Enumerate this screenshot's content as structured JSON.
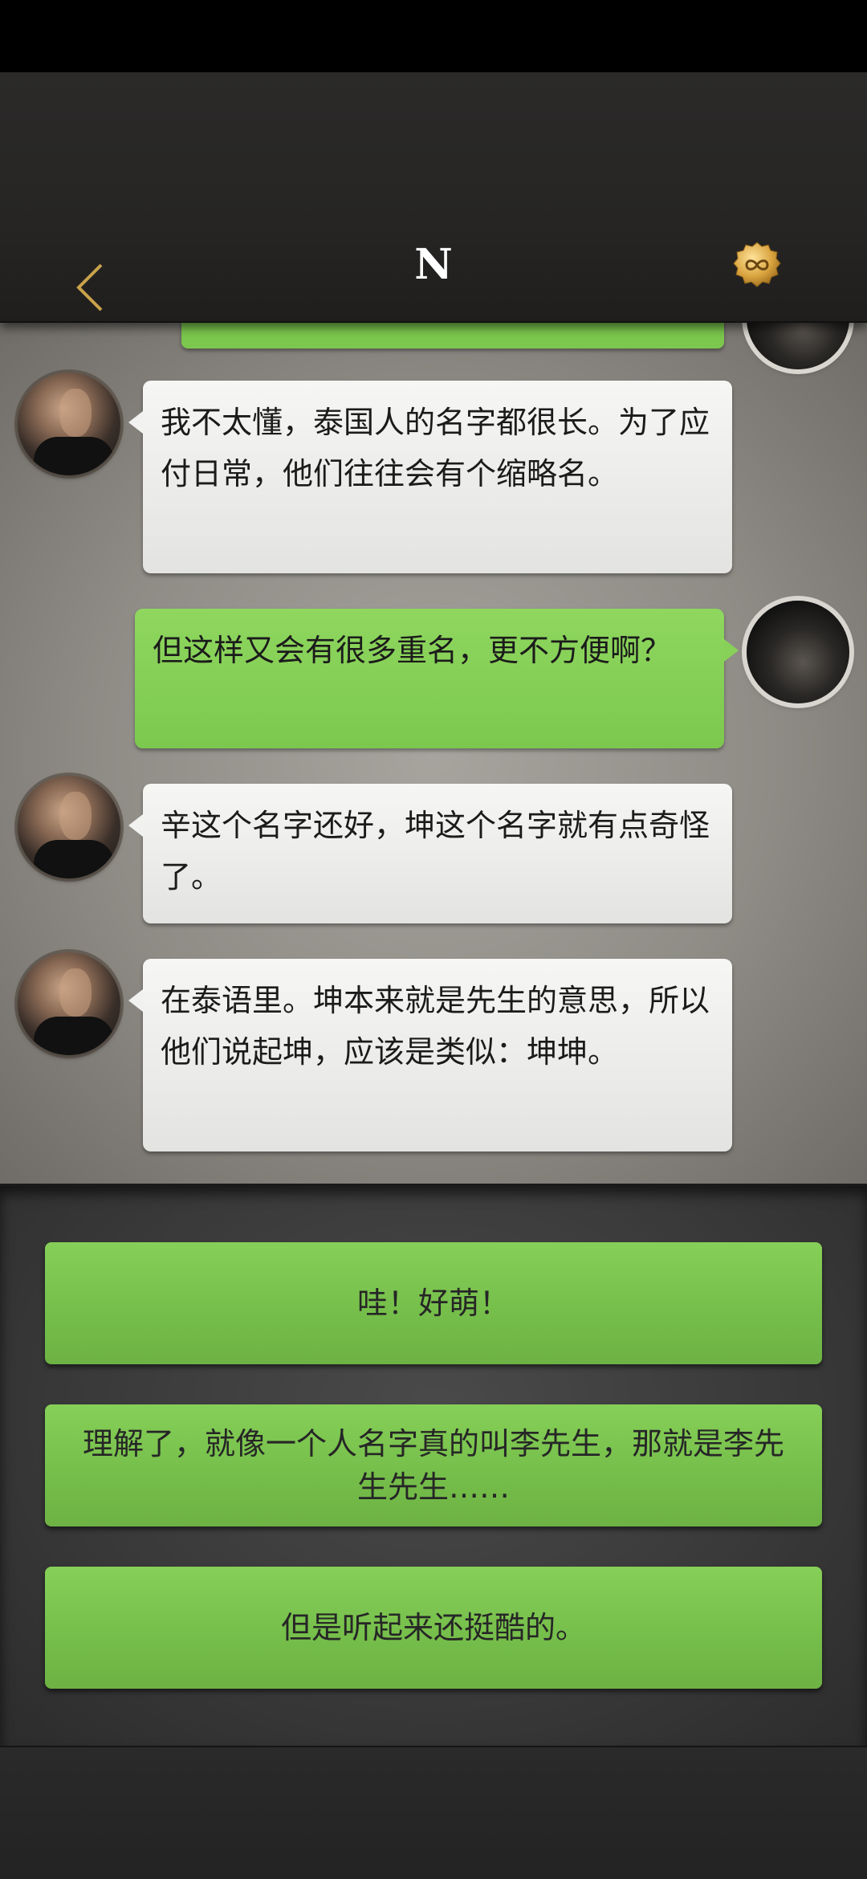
{
  "header": {
    "title": "N",
    "back_icon": "chevron-left-icon",
    "coin_icon": "infinity-coin-icon",
    "accent_color": "#c9a24a"
  },
  "messages": [
    {
      "side": "left",
      "text": "我不太懂，泰国人的名字都很长。为了应付日常，他们往往会有个缩略名。"
    },
    {
      "side": "right",
      "text": "但这样又会有很多重名，更不方便啊？"
    },
    {
      "side": "left",
      "text": "辛这个名字还好，坤这个名字就有点奇怪了。"
    },
    {
      "side": "left",
      "text": "在泰语里。坤本来就是先生的意思，所以他们说起坤，应该是类似：坤坤。"
    }
  ],
  "options": [
    {
      "label": "哇！好萌！"
    },
    {
      "label": "理解了，就像一个人名字真的叫李先生，那就是李先生先生……"
    },
    {
      "label": "但是听起来还挺酷的。"
    }
  ],
  "colors": {
    "bubble_right": "#7cc84e",
    "bubble_left": "#efefed",
    "option_green": "#76bf4b"
  }
}
